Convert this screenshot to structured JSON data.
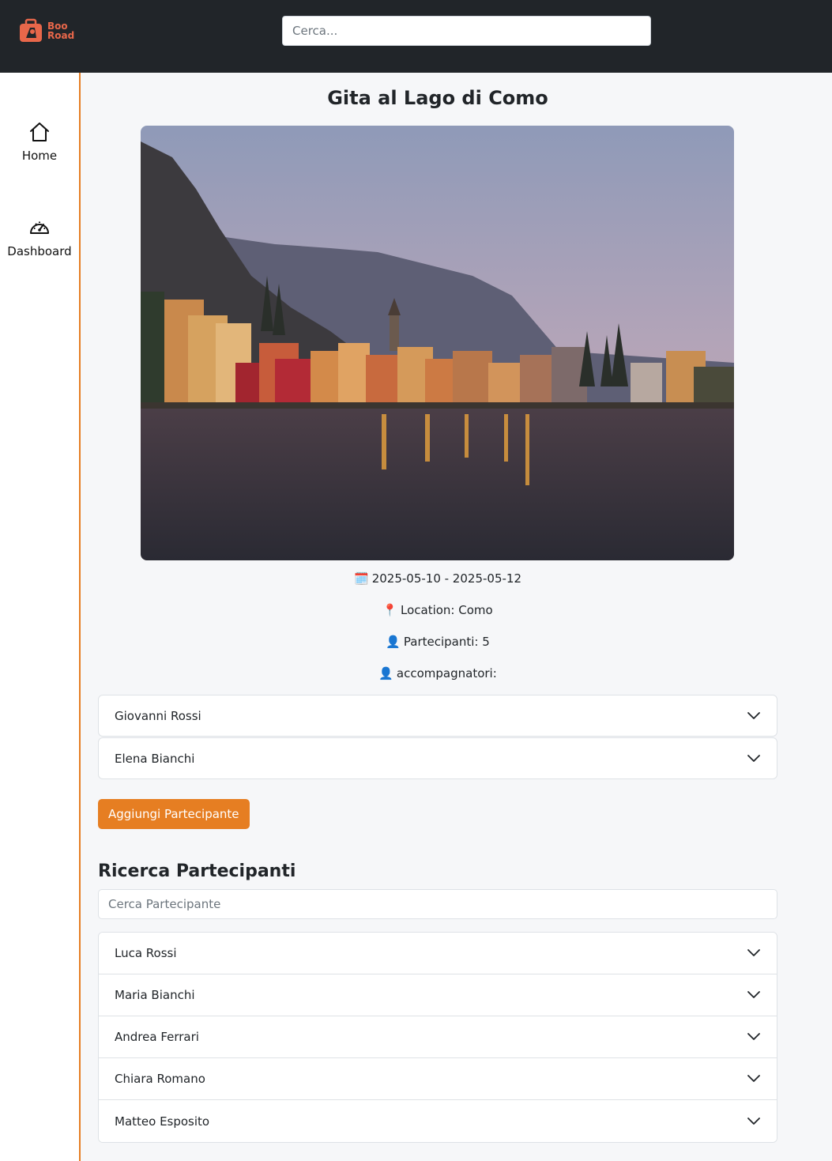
{
  "brand": {
    "logo_line1": "Boo",
    "logo_line2": "Road",
    "logo_icon": "suitcase-logo-icon",
    "accent_color": "#e8674a"
  },
  "header": {
    "search_placeholder": "Cerca..."
  },
  "sidebar": {
    "items": [
      {
        "label": "Home",
        "icon": "home-icon"
      },
      {
        "label": "Dashboard",
        "icon": "dashboard-gauge-icon"
      }
    ],
    "border_color": "#e67e22"
  },
  "trip": {
    "title": "Gita al Lago di Como",
    "date_icon": "🗓️",
    "dates": "2025-05-10 - 2025-05-12",
    "location_icon": "📍",
    "location": "Location: Como",
    "participants_icon": "👤",
    "participants": "Partecipanti: 5",
    "companions_icon": "👤",
    "companions_label": "accompagnatori:"
  },
  "companions": [
    "Giovanni Rossi",
    "Elena Bianchi"
  ],
  "add_participant_label": "Aggiungi Partecipante",
  "participant_search": {
    "title": "Ricerca Partecipanti",
    "placeholder": "Cerca Partecipante"
  },
  "participants_list": [
    "Luca Rossi",
    "Maria Bianchi",
    "Andrea Ferrari",
    "Chiara Romano",
    "Matteo Esposito"
  ],
  "colors": {
    "primary": "#e67e22",
    "topbar": "#212529",
    "background": "#f6f7f9"
  }
}
